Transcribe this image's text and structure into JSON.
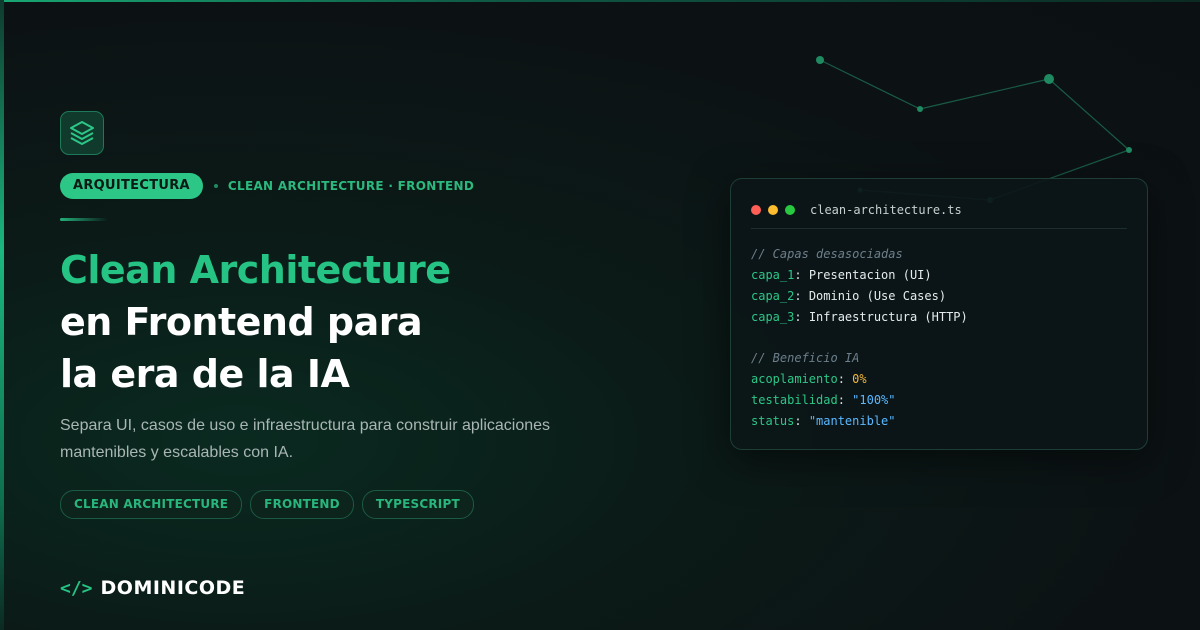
{
  "category_pill": "ARQUITECTURA",
  "category_meta": "CLEAN ARCHITECTURE · FRONTEND",
  "title": {
    "line1": "Clean Architecture",
    "line2": "en Frontend para",
    "line3": "la era de la IA"
  },
  "subtitle": "Separa UI, casos de uso e infraestructura para construir aplicaciones mantenibles y escalables con IA.",
  "tags": [
    "CLEAN ARCHITECTURE",
    "FRONTEND",
    "TYPESCRIPT"
  ],
  "brand": {
    "icon_text": "</>",
    "name": "DOMINICODE"
  },
  "code_window": {
    "filename": "clean-architecture.ts",
    "comment1": "// Capas desasociadas",
    "layers": [
      {
        "key": "capa_1",
        "value": "Presentacion (UI)"
      },
      {
        "key": "capa_2",
        "value": "Dominio (Use Cases)"
      },
      {
        "key": "capa_3",
        "value": "Infraestructura (HTTP)"
      }
    ],
    "comment2": "// Beneficio IA",
    "benefits": [
      {
        "key": "acoplamiento",
        "value": "0%"
      },
      {
        "key": "testabilidad",
        "value": "\"100%\""
      },
      {
        "key": "status",
        "value": "\"mantenible\""
      }
    ]
  },
  "icons": [
    "layers-icon",
    "code-brackets-icon"
  ],
  "colors": {
    "accent": "#25c484",
    "background": "#0c1214",
    "string": "#5ab8ff",
    "number": "#f4b73a"
  }
}
